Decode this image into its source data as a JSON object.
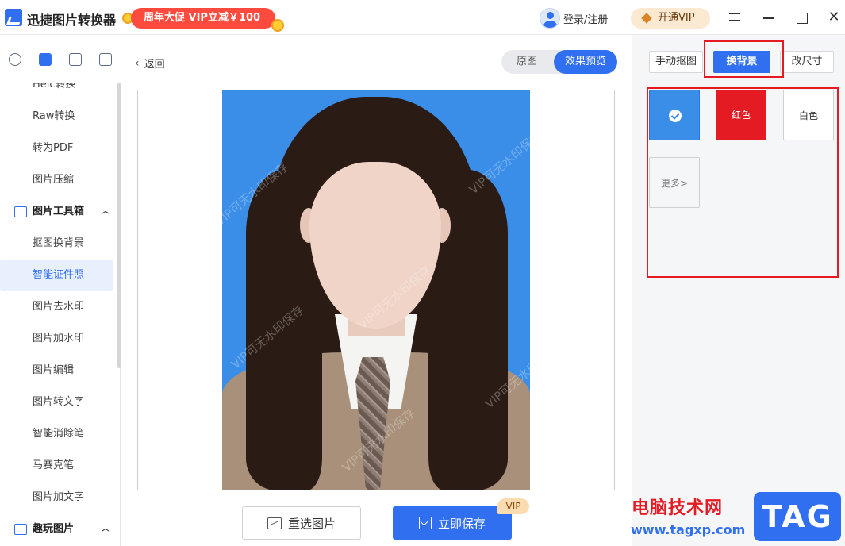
{
  "app": {
    "title": "迅捷图片转换器",
    "promo": "周年大促 VIP立减￥100",
    "login": "登录/注册",
    "vip_button": "开通VIP"
  },
  "sidebar": {
    "items": [
      {
        "label": "Heic转换"
      },
      {
        "label": "Raw转换"
      },
      {
        "label": "转为PDF"
      },
      {
        "label": "图片压缩"
      }
    ],
    "group_toolbox": "图片工具箱",
    "toolbox_items": [
      {
        "label": "抠图换背景"
      },
      {
        "label": "智能证件照"
      },
      {
        "label": "图片去水印"
      },
      {
        "label": "图片加水印"
      },
      {
        "label": "图片编辑"
      },
      {
        "label": "图片转文字"
      },
      {
        "label": "智能消除笔"
      },
      {
        "label": "马赛克笔"
      },
      {
        "label": "图片加文字"
      }
    ],
    "group_fun": "趣玩图片"
  },
  "main": {
    "back": "返回",
    "toggle_original": "原图",
    "toggle_preview": "效果预览",
    "watermark": "VIP可无水印保存",
    "reselect": "重选图片",
    "save": "立即保存",
    "vip_tag": "VIP"
  },
  "right": {
    "tabs": [
      "手动抠图",
      "换背景",
      "改尺寸"
    ],
    "swatch_red": "红色",
    "swatch_white": "白色",
    "swatch_more": "更多>"
  },
  "overlay": {
    "site_cn": "电脑技术网",
    "site_url": "www.tagxp.com",
    "tag": "TAG"
  },
  "colors": {
    "accent": "#2f6ff0",
    "bg_blue": "#3b8ee8",
    "red": "#e51b23"
  }
}
